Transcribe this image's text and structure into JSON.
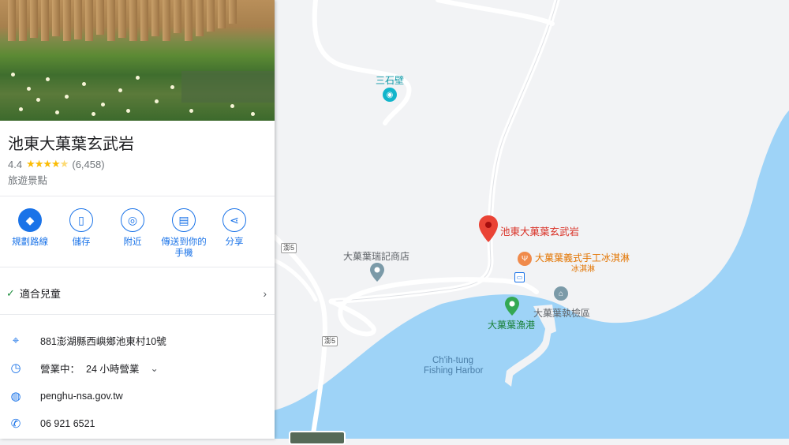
{
  "place": {
    "name": "池東大菓葉玄武岩",
    "rating": "4.4",
    "reviews": "(6,458)",
    "category": "旅遊景點",
    "stars_value": 4.5
  },
  "actions": [
    {
      "label": "規劃路線",
      "icon": "directions-icon"
    },
    {
      "label": "儲存",
      "icon": "bookmark-icon"
    },
    {
      "label": "附近",
      "icon": "nearby-icon"
    },
    {
      "label": "傳送到你的\n手機",
      "icon": "send-to-phone-icon"
    },
    {
      "label": "分享",
      "icon": "share-icon"
    }
  ],
  "amenity": {
    "label": "適合兒童"
  },
  "info": {
    "address": "881澎湖縣西嶼鄉池東村10號",
    "hours_status": "營業中：",
    "hours_detail": "24 小時營業",
    "website": "penghu-nsa.gov.tw",
    "phone": "06 921 6521"
  },
  "map": {
    "labels": {
      "sanshibi": "三石壁",
      "selected_place": "池東大菓葉玄武岩",
      "shop": "大菓葉瑞記商店",
      "icecream_1": "大菓葉義式手工冰淇淋",
      "icecream_2": "冰淇淋",
      "checkpoint": "大菓葉執檢區",
      "fishing_port": "大菓葉漁港",
      "harbor_en_1": "Ch'ih-tung",
      "harbor_en_2": "Fishing Harbor",
      "road_1": "澎5",
      "road_2": "澎5"
    },
    "colors": {
      "water": "#9ed3f7",
      "land": "#f2f3f5",
      "road": "#ffffff",
      "pin": "#ea4335",
      "teal_poi": "#12b5cb",
      "orange_poi": "#f08a4b",
      "green_poi": "#34a853",
      "gray_poi": "#7b9aa8"
    }
  }
}
